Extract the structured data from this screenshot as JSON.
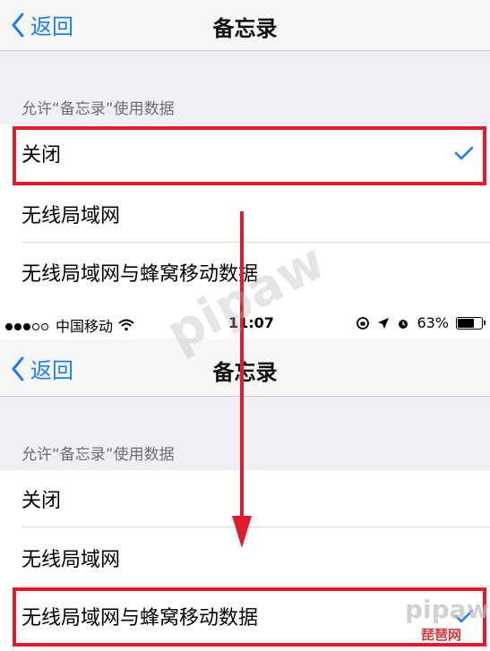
{
  "screens": [
    {
      "nav": {
        "back_label": "返回",
        "title": "备忘录"
      },
      "section_header": "允许“备忘录”使用数据",
      "options": [
        {
          "label": "关闭",
          "checked": true
        },
        {
          "label": "无线局域网",
          "checked": false
        },
        {
          "label": "无线局域网与蜂窝移动数据",
          "checked": false
        }
      ]
    },
    {
      "status_bar": {
        "carrier": "中国移动",
        "time": "11:07",
        "battery": "63%"
      },
      "nav": {
        "back_label": "返回",
        "title": "备忘录"
      },
      "section_header": "允许“备忘录”使用数据",
      "options": [
        {
          "label": "关闭",
          "checked": false
        },
        {
          "label": "无线局域网",
          "checked": false
        },
        {
          "label": "无线局域网与蜂窝移动数据",
          "checked": true
        }
      ]
    }
  ],
  "annotations": {
    "highlight_color": "#e21b2c",
    "check_color": "#1d7cf2"
  },
  "watermark": {
    "text": "pipaw",
    "site_label": "琵琶网"
  }
}
